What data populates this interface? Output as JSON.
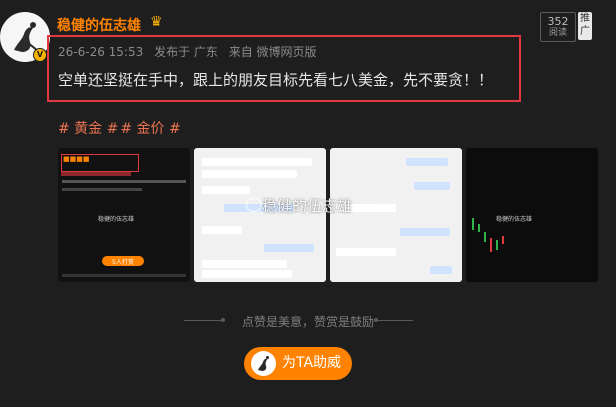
{
  "post": {
    "author": "稳健的伍志雄",
    "reads": {
      "count": "352",
      "label": "阅读"
    },
    "promote": "推广",
    "meta": {
      "time": "26-6-26 15:53",
      "location": "发布于 广东",
      "source": "来自 微博网页版"
    },
    "content": "空单还坚挺在手中，跟上的朋友目标先看七八美金，先不要贪！！",
    "tags": [
      "# 黄金 #",
      "# 金价 #"
    ]
  },
  "gallery": {
    "watermark": "稳健的伍志雄",
    "watermark_sub": "微博",
    "thumb1": {
      "name": "稳健的伍志雄",
      "reward": "5人打赏"
    },
    "thumb4": {
      "name": "稳健的伍志雄"
    }
  },
  "footer": {
    "divider_text": "点赞是美意，赞赏是鼓励",
    "reward_button": "为TA助威"
  },
  "colors": {
    "accent": "#ff8200",
    "highlight": "#e0383f",
    "tag": "#eb7350"
  }
}
